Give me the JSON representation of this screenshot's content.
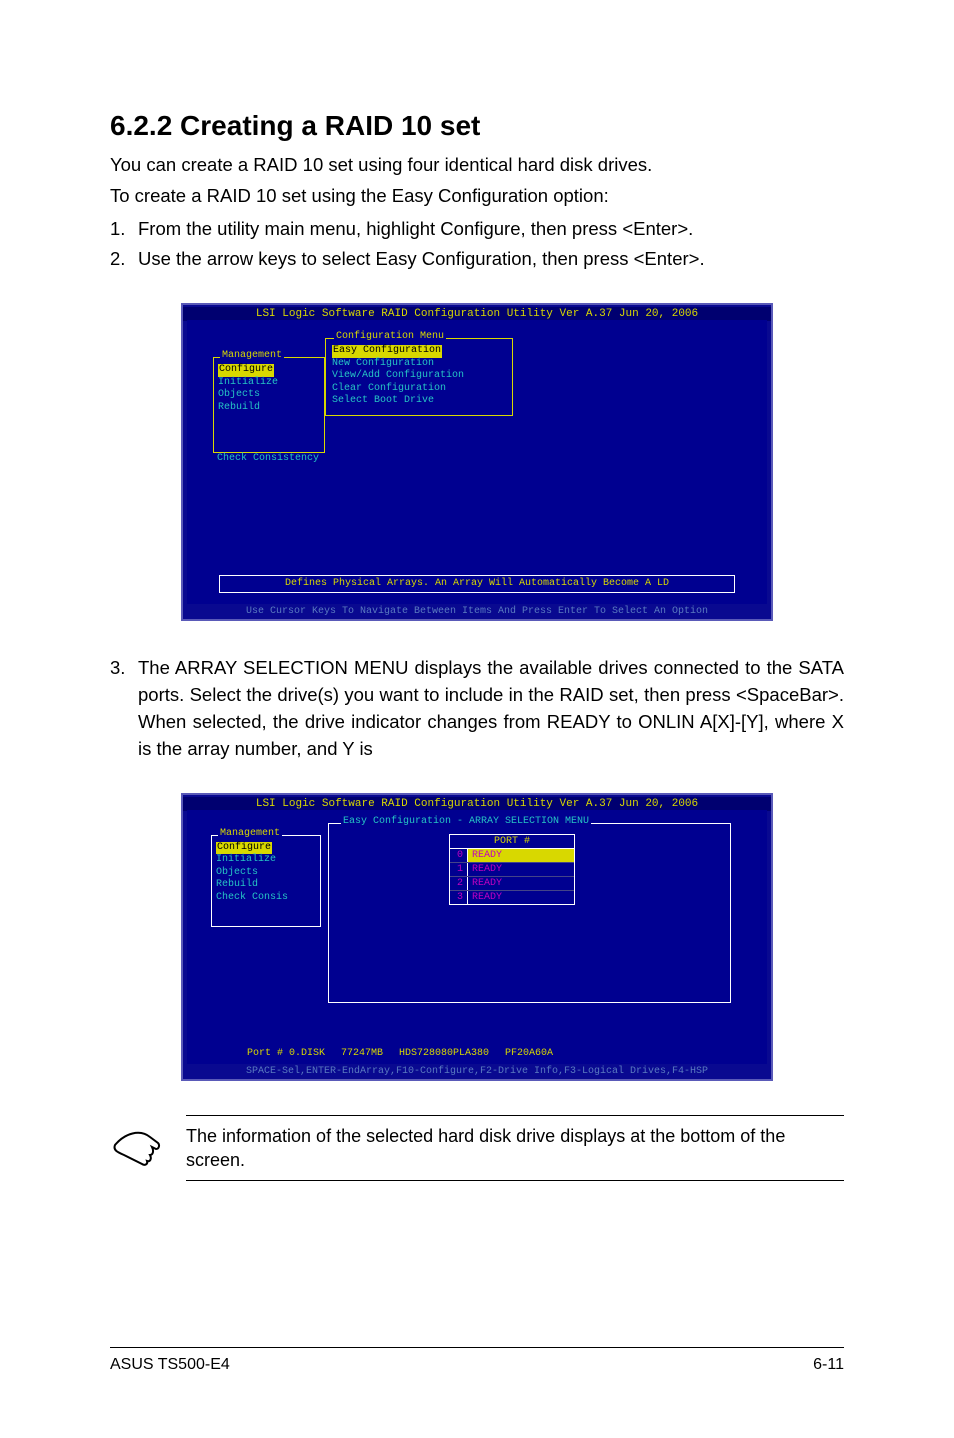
{
  "heading": "6.2.2 Creating a RAID 10 set",
  "intro1": "You can create a RAID 10 set using four identical hard disk drives.",
  "intro2": "To create a RAID 10 set using the Easy Configuration option:",
  "steps": [
    {
      "num": "1.",
      "text": "From the utility main menu, highlight Configure, then press <Enter>."
    },
    {
      "num": "2.",
      "text": "Use the arrow keys to select Easy Configuration, then press <Enter>."
    },
    {
      "num": "3.",
      "text": "The ARRAY SELECTION MENU displays the available drives connected to the SATA ports. Select the drive(s) you want to include in the RAID set, then press <SpaceBar>. When selected, the drive indicator changes from READY to ONLIN A[X]-[Y], where X is the array number, and Y is"
    }
  ],
  "shot1": {
    "title": "LSI Logic Software RAID Configuration Utility Ver A.37 Jun 20, 2006",
    "mgmt_title": "Management",
    "mgmt_items": {
      "i0": "Configure",
      "i1": "Initialize",
      "i2": "Objects",
      "i3": "Rebuild"
    },
    "chk": "Check Consistency",
    "cfg_title": "Configuration Menu",
    "cfg_items": {
      "i0": "Easy Configuration",
      "i1": "New Configuration",
      "i2": "View/Add Configuration",
      "i3": "Clear Configuration",
      "i4": "Select Boot Drive"
    },
    "help": "Defines Physical Arrays. An Array Will Automatically Become A LD",
    "footer": "Use Cursor Keys To Navigate Between Items And Press Enter To Select An Option"
  },
  "shot2": {
    "title": "LSI Logic Software RAID Configuration Utility Ver A.37 Jun 20, 2006",
    "mgmt_title": "Management",
    "mgmt_items": {
      "i0": "Configure",
      "i1": "Initialize",
      "i2": "Objects",
      "i3": "Rebuild",
      "i4": "Check Consis"
    },
    "ec_title": "Easy Configuration - ARRAY SELECTION MENU",
    "port_head": "PORT #",
    "ports": [
      {
        "n": "0",
        "s": "READY"
      },
      {
        "n": "1",
        "s": "READY"
      },
      {
        "n": "2",
        "s": "READY"
      },
      {
        "n": "3",
        "s": "READY"
      }
    ],
    "drive": {
      "c0": "Port # 0.DISK",
      "c1": "77247MB",
      "c2": "HDS728080PLA380",
      "c3": "PF20A60A"
    },
    "footer": "SPACE-Sel,ENTER-EndArray,F10-Configure,F2-Drive Info,F3-Logical Drives,F4-HSP"
  },
  "note": "The information of the selected hard disk drive displays at the bottom of the screen.",
  "footer": {
    "left": "ASUS TS500-E4",
    "right": "6-11"
  }
}
